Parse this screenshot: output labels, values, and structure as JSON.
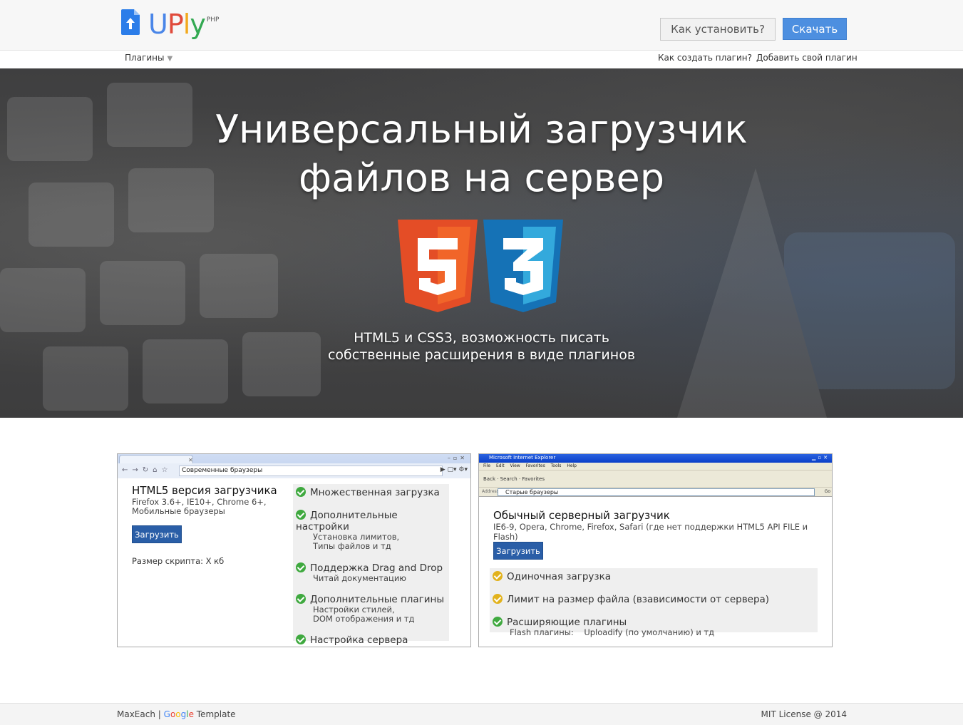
{
  "header": {
    "logo": {
      "letters": [
        "U",
        "P",
        "l",
        "y"
      ],
      "suffix": "PHP"
    },
    "install_button": "Как установить?",
    "download_button": "Скачать"
  },
  "subnav": {
    "plugins_label": "Плагины",
    "plugins_arrow": "▼",
    "how_to_create": "Как создать плагин?",
    "add_plugin": "Добавить свой плагин"
  },
  "hero": {
    "title_line1": "Универсальный загрузчик",
    "title_line2": "файлов на сервер",
    "subtitle_line1": "HTML5 и CSS3, возможность писать",
    "subtitle_line2": "собственные расширения в виде плагинов",
    "badges": [
      {
        "icon": "html5-icon",
        "glyph": "5",
        "color": "#e44d26"
      },
      {
        "icon": "css3-icon",
        "glyph": "3",
        "color": "#1572b6"
      }
    ]
  },
  "left_card": {
    "browser_url": "Современные браузеры",
    "title": "HTML5 версия загрузчика",
    "desc_line1": "Firefox 3.6+, IE10+, Chrome 6+,",
    "desc_line2": "Мобильные браузеры",
    "upload_button": "Загрузить",
    "script_size": "Размер скрипта: X кб",
    "features": [
      {
        "title": "Множественная загрузка",
        "sub1": "",
        "sub2": ""
      },
      {
        "title": "Дополнительные настройки",
        "sub1": "Установка лимитов,",
        "sub2": "Типы файлов и тд"
      },
      {
        "title": "Поддержка Drag and Drop",
        "sub1": "Читай документацию",
        "sub2": ""
      },
      {
        "title": "Дополнительные плагины",
        "sub1": "Настройки стилей,",
        "sub2": "DOM отображения и тд"
      },
      {
        "title": "Настройка сервера",
        "sub1": "",
        "sub2": ""
      }
    ]
  },
  "right_card": {
    "window_title": "Microsoft Internet Explorer",
    "menu": "File Edit View Favorites Tools Help",
    "toolbar": "Back · Search · Favorites",
    "address_label": "Address",
    "go_label": "Go",
    "browser_url": "Старые браузеры",
    "title": "Обычный серверный загрузчик",
    "desc": "IE6-9, Opera, Chrome, Firefox, Safari (где нет поддержки HTML5 API FILE и Flash)",
    "upload_button": "Загрузить",
    "features": [
      {
        "title": "Одиночная загрузка",
        "status": "partial"
      },
      {
        "title": "Лимит на размер файла (взависимости от сервера)",
        "status": "partial"
      },
      {
        "title": "Расширяющие плагины",
        "status": "ok",
        "sub": "Flash плагины:    Uploadify (по умолчанию) и тд"
      }
    ]
  },
  "footer": {
    "author": "MaxEach",
    "separator": " | ",
    "google": [
      "G",
      "o",
      "o",
      "g",
      "l",
      "e"
    ],
    "template_word": " Template",
    "license": "MIT License @ 2014"
  }
}
